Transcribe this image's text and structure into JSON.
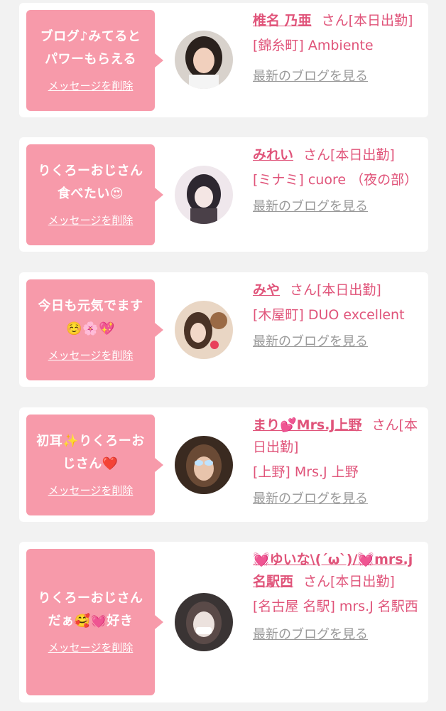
{
  "delete_label": "メッセージを削除",
  "blog_label": "最新のブログを見る",
  "cards": [
    {
      "message": "ブログ♪みてると\nパワーもらえる",
      "name": "椎名 乃亜",
      "status": "さん[本日出勤]",
      "shop": "[錦糸町] Ambiente"
    },
    {
      "message": "りくろーおじさん\n食べたい😍",
      "name": "みれい",
      "status": "さん[本日出勤]",
      "shop": "[ミナミ] cuore （夜の部）"
    },
    {
      "message": "今日も元気でます\n☺️🌸💖",
      "name": "みや",
      "status": "さん[本日出勤]",
      "shop": "[木屋町] DUO excellent"
    },
    {
      "message": "初耳✨りくろーお\nじさん❤️",
      "name": "まり💕Mrs.J上野",
      "status": "さん[本日出勤]",
      "shop": "[上野] Mrs.J 上野"
    },
    {
      "message": "りくろーおじさん\nだぁ🥰💓好き",
      "name": "💓ゆいな\\(´ω`)/💓mrs.j名駅西",
      "status": "さん[本日出勤]",
      "shop": "[名古屋 名駅] mrs.J 名駅西"
    }
  ]
}
